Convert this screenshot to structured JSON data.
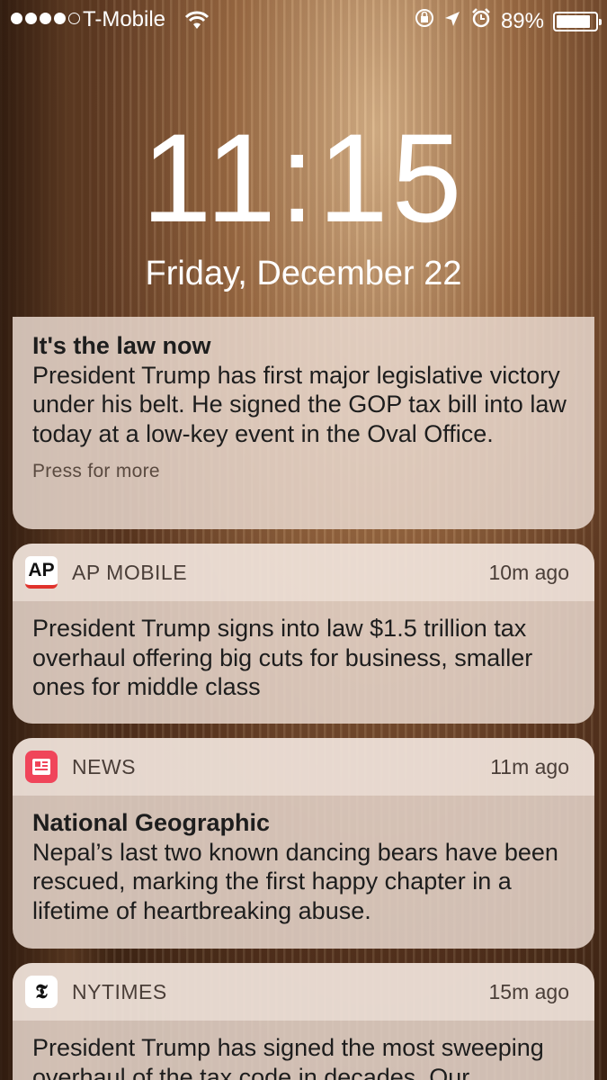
{
  "status_bar": {
    "carrier": "T-Mobile",
    "signal_bars_filled": 4,
    "signal_bars_total": 5,
    "battery_percent": "89%",
    "battery_level": 0.89,
    "icons": [
      "wifi-icon",
      "orientation-lock-icon",
      "location-icon",
      "alarm-icon",
      "battery-icon"
    ]
  },
  "lock_screen": {
    "time": "11:15",
    "date": "Friday, December 22"
  },
  "notifications": [
    {
      "app": "",
      "time": "",
      "title": "It's the law now",
      "body": "President Trump has first major legislative victory under his belt. He signed the GOP tax bill into law today at a low-key event in the Oval Office.",
      "footer": "Press for more"
    },
    {
      "app": "AP MOBILE",
      "icon_text": "AP",
      "time": "10m ago",
      "title": "",
      "body": "President Trump signs into law $1.5 trillion tax overhaul offering big cuts for business, smaller ones for middle class"
    },
    {
      "app": "NEWS",
      "time": "11m ago",
      "title": "National Geographic",
      "body": "Nepal’s last two known dancing bears have been rescued, marking the first happy chapter in a lifetime of heartbreaking abuse."
    },
    {
      "app": "NYTIMES",
      "icon_text": "𝕿",
      "time": "15m ago",
      "title": "",
      "body": "President Trump has signed the most sweeping overhaul of the tax code in decades. Our"
    }
  ],
  "colors": {
    "ap_icon_red": "#e0322c",
    "news_icon_red": "#f0455a"
  }
}
